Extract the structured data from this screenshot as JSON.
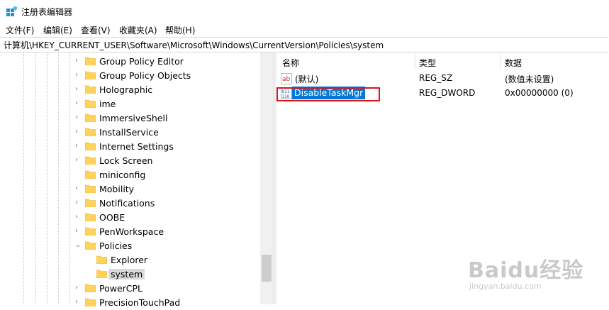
{
  "window": {
    "title": "注册表编辑器"
  },
  "menu": [
    "文件(F)",
    "编辑(E)",
    "查看(V)",
    "收藏夹(A)",
    "帮助(H)"
  ],
  "address": "计算机\\HKEY_CURRENT_USER\\Software\\Microsoft\\Windows\\CurrentVersion\\Policies\\system",
  "tree": {
    "items": [
      {
        "label": "Group Policy Editor"
      },
      {
        "label": "Group Policy Objects"
      },
      {
        "label": "Holographic"
      },
      {
        "label": "ime"
      },
      {
        "label": "ImmersiveShell"
      },
      {
        "label": "InstallService"
      },
      {
        "label": "Internet Settings"
      },
      {
        "label": "Lock Screen"
      },
      {
        "label": "miniconfig"
      },
      {
        "label": "Mobility"
      },
      {
        "label": "Notifications"
      },
      {
        "label": "OOBE"
      },
      {
        "label": "PenWorkspace"
      },
      {
        "label": "Policies"
      },
      {
        "label": "Explorer"
      },
      {
        "label": "system"
      },
      {
        "label": "PowerCPL"
      },
      {
        "label": "PrecisionTouchPad"
      }
    ]
  },
  "list": {
    "columns": [
      "名称",
      "类型",
      "数据"
    ],
    "rows": [
      {
        "name": "(默认)",
        "type": "REG_SZ",
        "data": "(数值未设置)",
        "icon": "string-value-icon"
      },
      {
        "name": "DisableTaskMgr",
        "type": "REG_DWORD",
        "data": "0x00000000 (0)",
        "icon": "dword-value-icon"
      }
    ]
  },
  "watermark": {
    "main": "Baidu经验",
    "sub": "jingyan.baidu.com"
  },
  "colors": {
    "selection": "#0078d7",
    "highlight_box": "#e0141e",
    "folder": "#ffd35a"
  }
}
